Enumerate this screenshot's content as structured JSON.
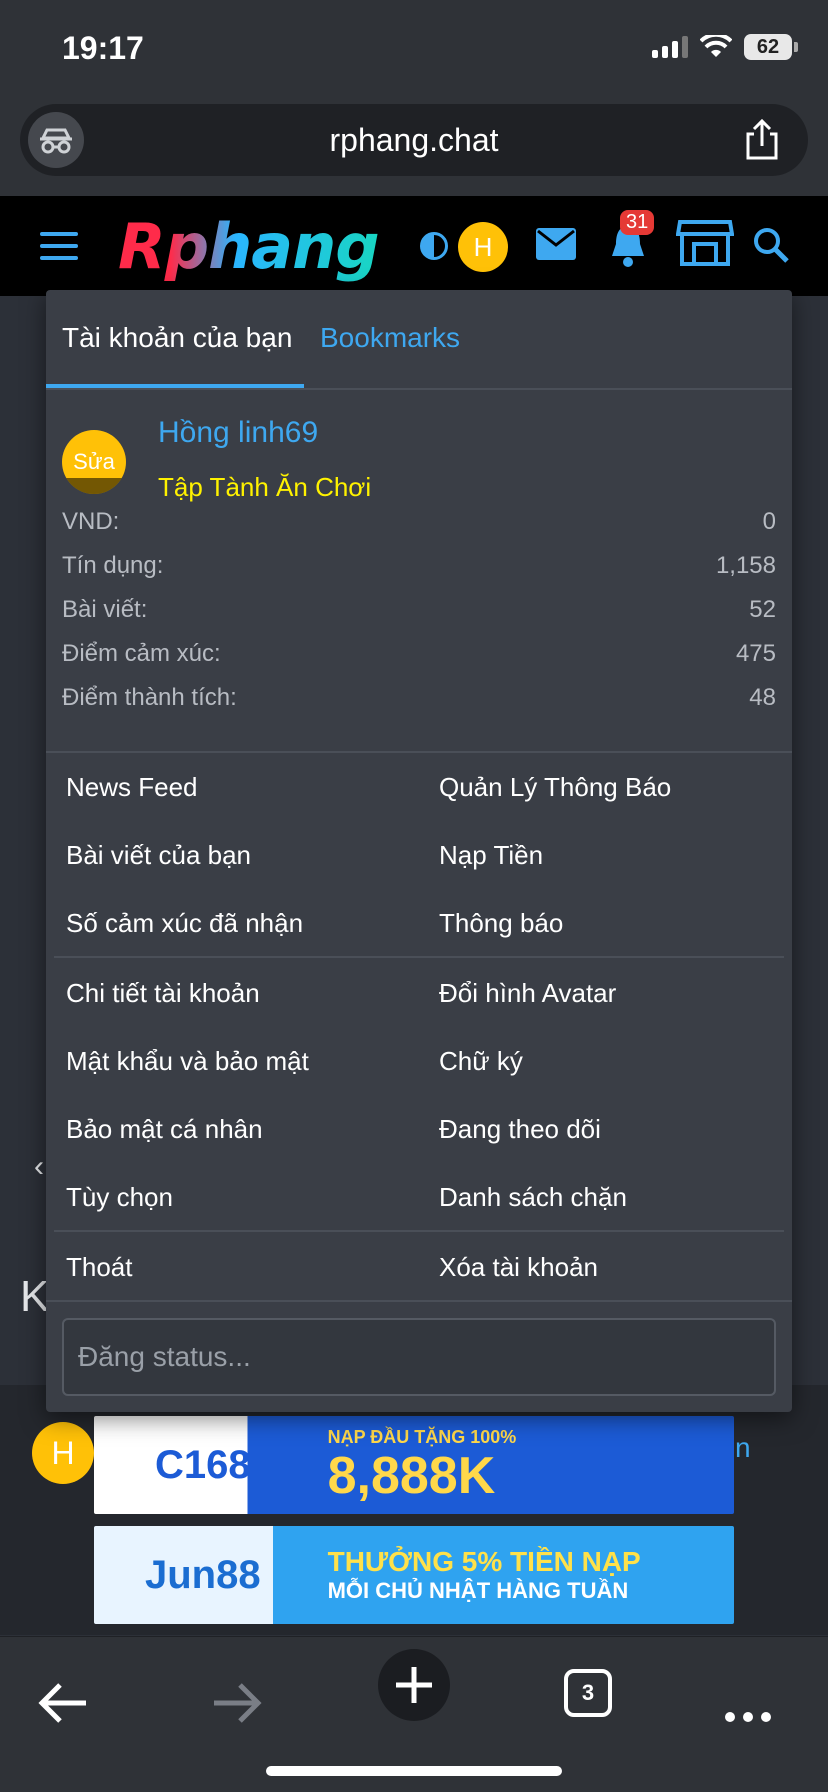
{
  "status_bar": {
    "time": "19:17",
    "battery": "62"
  },
  "browser": {
    "url": "rphang.chat",
    "tab_count": "3"
  },
  "site_header": {
    "logo_text": "Rphang",
    "avatar_initial": "H",
    "notification_count": "31"
  },
  "menu": {
    "tabs": {
      "account": "Tài khoản của bạn",
      "bookmarks": "Bookmarks"
    },
    "profile": {
      "avatar_label": "Sửa",
      "name": "Hồng linh69",
      "title": "Tập Tành Ăn Chơi"
    },
    "stats": [
      {
        "label": "VND:",
        "value": "0"
      },
      {
        "label": "Tín dụng:",
        "value": "1,158"
      },
      {
        "label": "Bài viết:",
        "value": "52"
      },
      {
        "label": "Điểm cảm xúc:",
        "value": "475"
      },
      {
        "label": "Điểm thành tích:",
        "value": "48"
      }
    ],
    "links_group1": {
      "left": [
        "News Feed",
        "Bài viết của bạn",
        "Số cảm xúc đã nhận"
      ],
      "right": [
        "Quản Lý Thông Báo",
        "Nạp Tiền",
        "Thông báo"
      ]
    },
    "links_group2": {
      "left": [
        "Chi tiết tài khoản",
        "Mật khẩu và bảo mật",
        "Bảo mật cá nhân",
        "Tùy chọn"
      ],
      "right": [
        "Đổi hình Avatar",
        "Chữ ký",
        "Đang theo dõi",
        "Danh sách chặn"
      ]
    },
    "links_group3": {
      "left": [
        "Thoát"
      ],
      "right": [
        "Xóa tài khoản"
      ]
    },
    "status_placeholder": "Đăng status..."
  },
  "background": {
    "chevron": "‹",
    "heading_fragment": "K",
    "avatar_initial": "H",
    "link_fragment": "n"
  },
  "ads": [
    {
      "brand": "C168",
      "promo_top": "NẠP ĐẦU TẶNG 100%",
      "promo_main": "8,888K"
    },
    {
      "brand": "Jun88",
      "promo_top": "THƯỞNG 5% TIỀN NẠP",
      "promo_main": "MỖI CHỦ NHẬT HÀNG TUẦN"
    }
  ],
  "colors": {
    "accent": "#3ea8f0",
    "title_yellow": "#fff200",
    "avatar": "#ffc107",
    "badge": "#e53935"
  }
}
